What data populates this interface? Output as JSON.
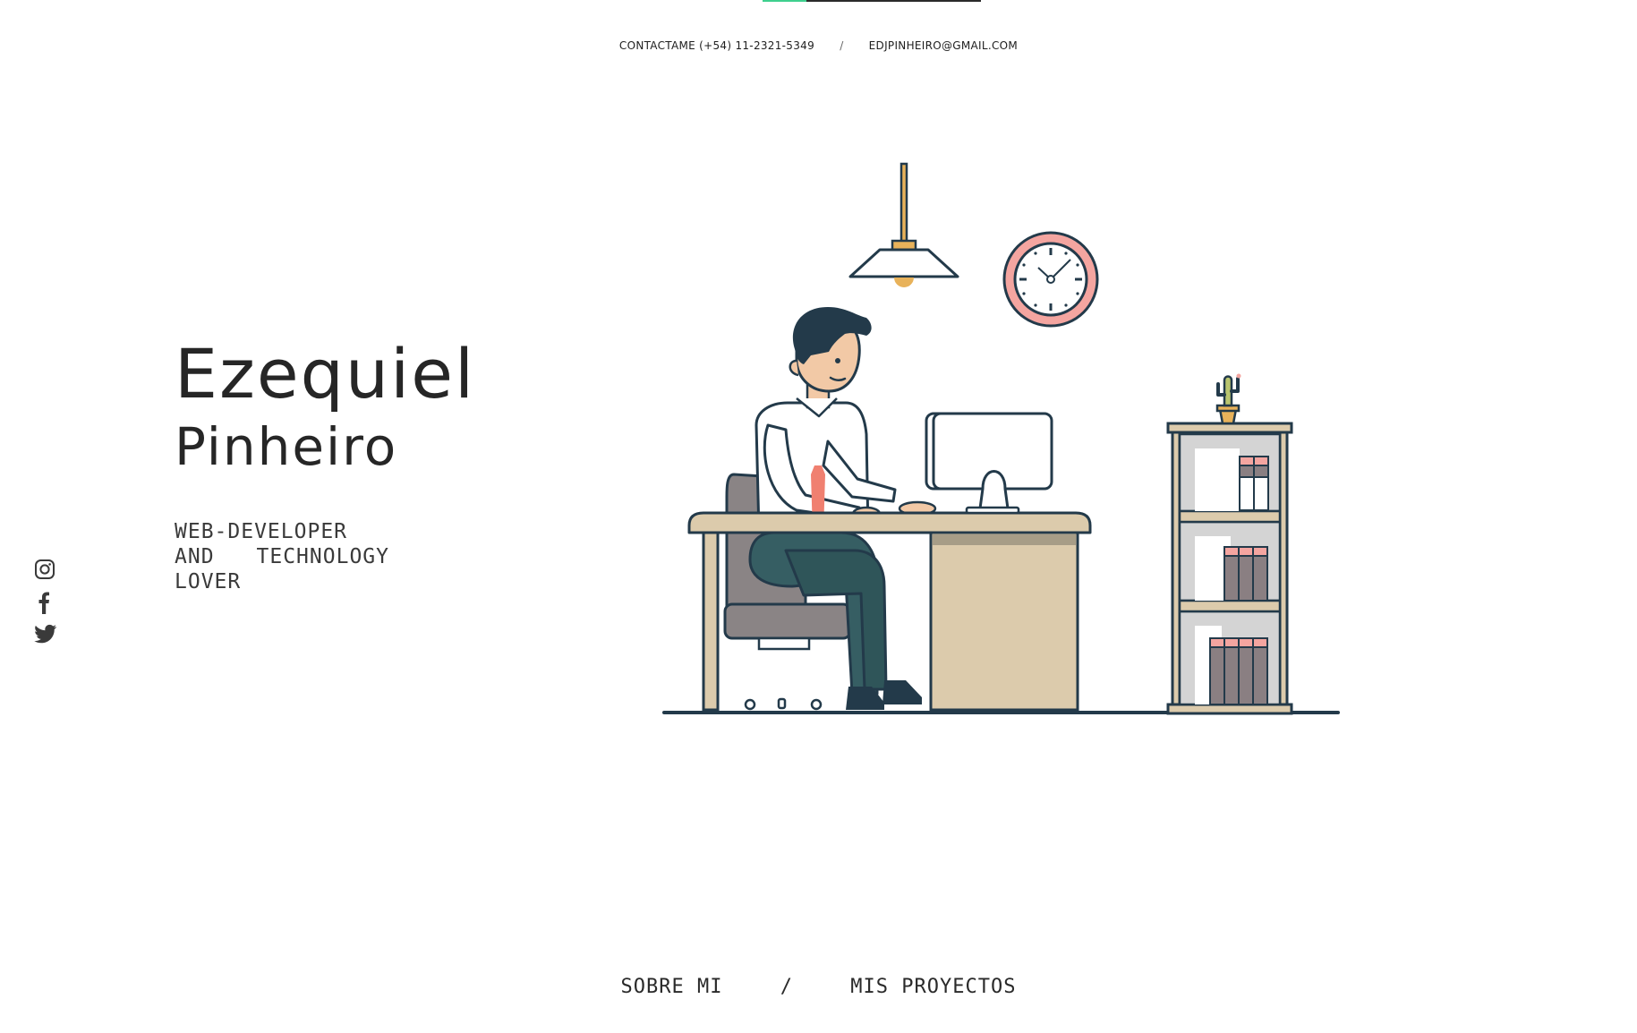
{
  "scroll_progress": 0.2,
  "contact": {
    "phone_text": "CONTACTAME (+54) 11-2321-5349",
    "separator": "/",
    "email_text": "EDJPINHEIRO@GMAIL.COM"
  },
  "hero": {
    "first_name": "Ezequiel",
    "last_name": "Pinheiro",
    "tagline": {
      "line1": [
        "WEB-DEVELOPER"
      ],
      "line2": [
        "AND",
        "TECHNOLOGY"
      ],
      "line3": [
        "LOVER"
      ]
    }
  },
  "social": [
    {
      "icon": "instagram-icon"
    },
    {
      "icon": "facebook-icon"
    },
    {
      "icon": "twitter-icon"
    }
  ],
  "nav": {
    "about_label": "SOBRE MI",
    "separator": "/",
    "projects_label": "MIS PROYECTOS"
  },
  "colors": {
    "accent": "#3ecf8e",
    "outline": "#233a4a",
    "desk": "#dccbac",
    "tie": "#f08070",
    "clock_ring": "#f4a5a0",
    "lamp": "#e8b25a"
  }
}
